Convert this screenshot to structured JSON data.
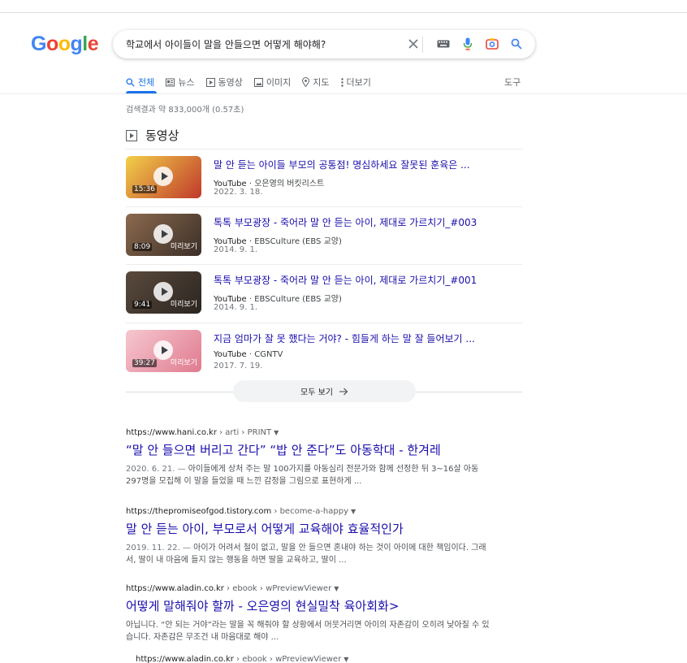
{
  "logo": [
    "G",
    "o",
    "o",
    "g",
    "l",
    "e"
  ],
  "logo_colors": [
    "#4285f4",
    "#ea4335",
    "#fbbc05",
    "#4285f4",
    "#34a853",
    "#ea4335"
  ],
  "search": {
    "query": "학교에서 아이들이 말을 안들으면 어떻게 해야해?"
  },
  "tabs": [
    {
      "label": "전체",
      "icon": "search-icon",
      "active": true
    },
    {
      "label": "뉴스",
      "icon": "news-icon"
    },
    {
      "label": "동영상",
      "icon": "video-icon"
    },
    {
      "label": "이미지",
      "icon": "image-icon"
    },
    {
      "label": "지도",
      "icon": "map-pin-icon"
    },
    {
      "label": "더보기",
      "icon": "more-vert-icon"
    }
  ],
  "tools_label": "도구",
  "result_stats": "검색결과 약 833,000개 (0.57초)",
  "videos": {
    "header": "동영상",
    "items": [
      {
        "title": "말 안 듣는 아이들 부모의 공통점! 명심하세요 잘못된 훈육은 ...",
        "source": "YouTube",
        "channel": "오은영의 버킷리스트",
        "date": "2022. 3. 18.",
        "duration": "15:36",
        "preview": "",
        "thumb_colors": [
          "#f2d04a",
          "#c0392b"
        ]
      },
      {
        "title": "톡톡 부모광장 - 죽어라 말 안 듣는 아이, 제대로 가르치기_#003",
        "source": "YouTube",
        "channel": "EBSCulture (EBS 교양)",
        "date": "2014. 9. 1.",
        "duration": "8:09",
        "preview": "미리보기",
        "thumb_colors": [
          "#8b6a4e",
          "#3b2f28"
        ]
      },
      {
        "title": "톡톡 부모광장 - 죽어라 말 안 듣는 아이, 제대로 가르치기_#001",
        "source": "YouTube",
        "channel": "EBSCulture (EBS 교양)",
        "date": "2014. 9. 1.",
        "duration": "9:41",
        "preview": "미리보기",
        "thumb_colors": [
          "#5a4a3d",
          "#2b2520"
        ]
      },
      {
        "title": "지금 엄마가 잘 못 했다는 거야? - 힘들게 하는 말 잘 들어보기 ...",
        "source": "YouTube",
        "channel": "CGNTV",
        "date": "2017. 7. 19.",
        "duration": "39:27",
        "preview": "미리보기",
        "thumb_colors": [
          "#f6c7cf",
          "#e07b90"
        ]
      }
    ],
    "more_label": "모두 보기"
  },
  "results": [
    {
      "domain": "https://www.hani.co.kr",
      "path": " › arti › PRINT",
      "title": "“말 안 들으면 버리고 간다” “밥 안 준다”도 아동학대 - 한겨레",
      "date": "2020. 6. 21. — ",
      "snippet": "아이들에게 상처 주는 말 100가지를 아동심리 전문가와 함께 선정한 뒤 3~16살 아동 297명을 모집해 이 말을 들었을 때 느낀 감정을 그림으로 표현하게 ..."
    },
    {
      "domain": "https://thepromiseofgod.tistory.com",
      "path": " › become-a-happy",
      "title": "말 안 듣는 아이, 부모로서 어떻게 교육해야 효율적인가",
      "date": "2019. 11. 22. — ",
      "snippet": "아이가 어려서 철이 없고, 말을 안 들으면 혼내야 하는 것이 아이에 대한 책임이다. 그래서, 딸이 내 마음에 들지 않는 행동을 하면 딸을 교육하고, 딸이 ..."
    },
    {
      "domain": "https://www.aladin.co.kr",
      "path": " › ebook › wPreviewViewer",
      "title": "어떻게 말해줘야 할까 - 오은영의 현실밀착 육아회화>",
      "date": "",
      "snippet": "아닙니다. “안 되는 거야”라는 말을 꼭 해줘야 할 상황에서 머뭇거리면 아이의 자존감이 오히려 낮아질 수 있습니다. 자존감은 무조건 내 마음대로 해야 ..."
    },
    {
      "domain": "https://www.aladin.co.kr",
      "path": " › ebook › wPreviewViewer",
      "title": "",
      "date": "",
      "snippet": ""
    }
  ]
}
